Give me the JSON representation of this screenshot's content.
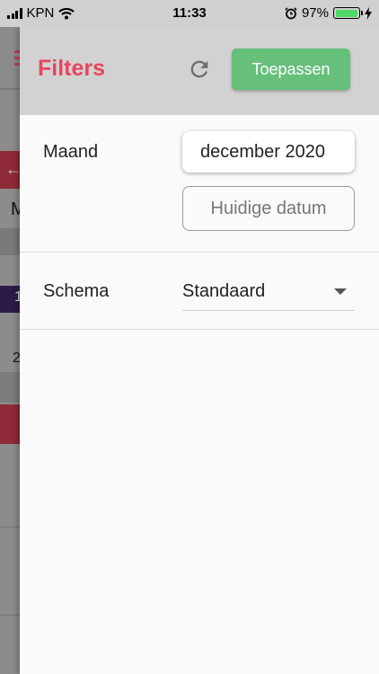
{
  "status_bar": {
    "carrier": "KPN",
    "time": "11:33",
    "battery": "97%",
    "battery_level": 0.97,
    "battery_color": "#4cd964"
  },
  "background_app": {
    "menu_icon": "hamburger-menu-icon",
    "back_icon": "arrow-left-icon",
    "fragments": [
      "M",
      "1",
      "2"
    ]
  },
  "drawer": {
    "title": "Filters",
    "title_color": "#e8455f",
    "refresh_icon": "refresh-icon",
    "apply_label": "Toepassen",
    "apply_color": "#66bf7b",
    "month": {
      "label": "Maand",
      "value": "december 2020",
      "today_label": "Huidige datum"
    },
    "schema": {
      "label": "Schema",
      "selected": "Standaard",
      "dropdown_icon": "caret-down-icon"
    }
  }
}
